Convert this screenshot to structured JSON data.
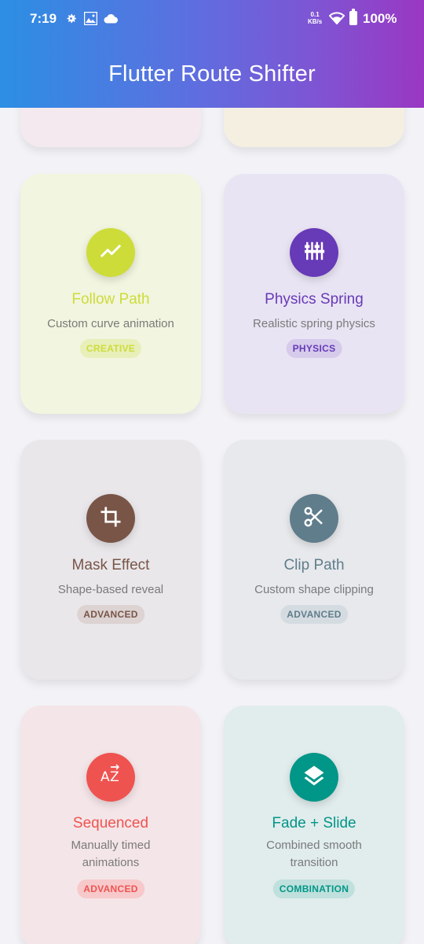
{
  "status_bar": {
    "time": "7:19",
    "net_speed_value": "0.1",
    "net_speed_unit": "KB/s",
    "battery": "100%"
  },
  "app_bar": {
    "title": "Flutter Route Shifter"
  },
  "cards": [
    {
      "title": "Follow Path",
      "subtitle": "Custom curve animation",
      "badge": "CREATIVE",
      "icon": "trending-line-icon",
      "accent": "#cddc39"
    },
    {
      "title": "Physics Spring",
      "subtitle": "Realistic spring physics",
      "badge": "PHYSICS",
      "icon": "tune-sliders-icon",
      "accent": "#673ab7"
    },
    {
      "title": "Mask Effect",
      "subtitle": "Shape-based reveal",
      "badge": "ADVANCED",
      "icon": "crop-icon",
      "accent": "#795548"
    },
    {
      "title": "Clip Path",
      "subtitle": "Custom shape clipping",
      "badge": "ADVANCED",
      "icon": "scissors-icon",
      "accent": "#607d8b"
    },
    {
      "title": "Sequenced",
      "subtitle_line1": "Manually timed",
      "subtitle_line2": "animations",
      "badge": "ADVANCED",
      "icon": "sort-az-icon",
      "accent": "#ef5350"
    },
    {
      "title": "Fade + Slide",
      "subtitle_line1": "Combined smooth",
      "subtitle_line2": "transition",
      "badge": "COMBINATION",
      "icon": "layers-icon",
      "accent": "#009688"
    }
  ]
}
